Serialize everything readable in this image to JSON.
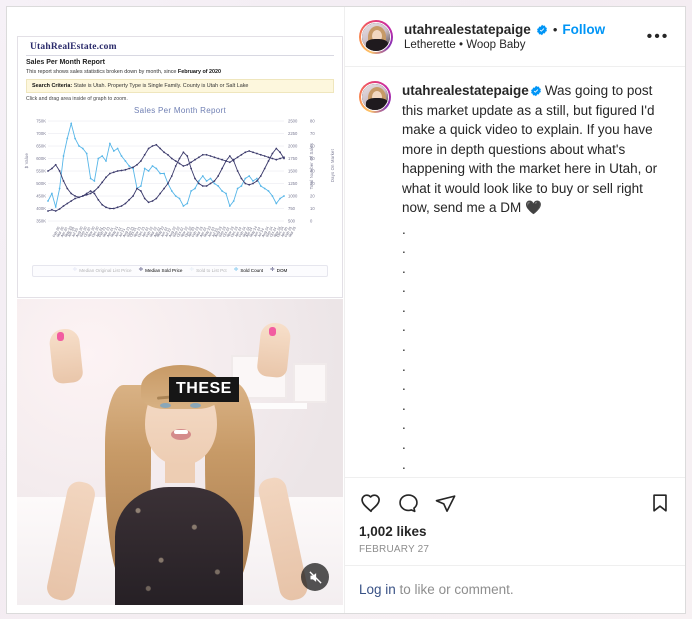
{
  "post": {
    "header": {
      "username": "utahrealestatepaige",
      "verified_icon": "verified-badge-icon",
      "separator": "•",
      "follow_label": "Follow",
      "location": "Letherette • Woop Baby",
      "more_menu": "•••"
    },
    "caption": {
      "username": "utahrealestatepaige",
      "text": "Was going to post this market update as a still, but figured I'd make a quick video to explain. If you have more in depth questions about what's happening with the market here in Utah, or what it would look like to buy or sell right now, send me a DM 🖤",
      "filler_dot": ".",
      "filler_dot_count": 13
    },
    "actions": {
      "like_icon": "heart-icon",
      "comment_icon": "comment-bubble-icon",
      "share_icon": "share-paper-plane-icon",
      "save_icon": "bookmark-icon"
    },
    "likes": "1,002 likes",
    "date": "FEBRUARY 27",
    "footer": {
      "link_label": "Log in",
      "rest_label": " to like or comment."
    },
    "media": {
      "mute_icon": "muted-speaker-icon",
      "video_caption": "THESE"
    }
  },
  "chart_shot": {
    "brand": "UtahRealEstate.com",
    "report_title": "Sales Per Month Report",
    "description_prefix": "This report shows sales statistics broken down by month, since ",
    "description_bold": "February of 2020",
    "criteria_label": "Search Criteria:",
    "criteria_value": " State is Utah.  Property Type is Single Family.  County is Utah or Salt Lake",
    "zoom_hint": "Click and drag area inside of graph to zoom."
  },
  "chart_data": {
    "type": "line",
    "title": "Sales Per Month Report",
    "xlabel": "",
    "ylabel": "$ Value",
    "y2label": "Total Number Of Sales",
    "y3label": "Days On Market",
    "ylim": [
      350000,
      750000
    ],
    "yticks": [
      "350K",
      "400K",
      "450K",
      "500K",
      "550K",
      "600K",
      "650K",
      "700K",
      "750K"
    ],
    "y2lim": [
      500,
      2500
    ],
    "y2ticks": [
      "500",
      "750",
      "1000",
      "1250",
      "1500",
      "1750",
      "2000",
      "2250",
      "2500"
    ],
    "y3lim": [
      0,
      80
    ],
    "y3ticks": [
      "0",
      "10",
      "20",
      "30",
      "40",
      "50",
      "60",
      "70",
      "80"
    ],
    "grid": true,
    "legend_position": "bottom",
    "legend": [
      {
        "name": "Median Original List Price",
        "color": "#9aa3d6",
        "active": false
      },
      {
        "name": "Median Sold Price",
        "color": "#3b3a6b",
        "active": true
      },
      {
        "name": "Sold to List Pct",
        "color": "#a8c6df",
        "active": false
      },
      {
        "name": "Sold Count",
        "color": "#57b6e8",
        "active": true
      },
      {
        "name": "DOM",
        "color": "#3b3a6b",
        "active": true
      }
    ],
    "categories": [
      "Feb 20",
      "Mar 20",
      "Apr 20",
      "May 20",
      "Jun 20",
      "Jul 20",
      "Aug 20",
      "Sep 20",
      "Oct 20",
      "Nov 20",
      "Dec 20",
      "Jan 21",
      "Feb 21",
      "Mar 21",
      "Apr 21",
      "May 21",
      "Jun 21",
      "Jul 21",
      "Aug 21",
      "Sep 21",
      "Oct 21",
      "Nov 21",
      "Dec 21",
      "Jan 22",
      "Feb 22",
      "Mar 22",
      "Apr 22",
      "May 22",
      "Jun 22",
      "Jul 22",
      "Aug 22",
      "Sep 22",
      "Oct 22",
      "Nov 22",
      "Dec 22",
      "Jan 23",
      "Feb 23",
      "Mar 23",
      "Apr 23",
      "May 23",
      "Jun 23",
      "Jul 23",
      "Aug 23",
      "Sep 23",
      "Oct 23",
      "Nov 23",
      "Dec 23",
      "Jan 24",
      "Feb 24",
      "Mar 24",
      "Apr 24",
      "May 24",
      "Jun 24",
      "Jul 24",
      "Aug 24",
      "Sep 24",
      "Oct 24",
      "Nov 24",
      "Dec 24",
      "Jan 25",
      "Feb 25",
      "Mar 25"
    ],
    "series": [
      {
        "name": "Sold Count",
        "axis": "y2",
        "color": "#57b6e8",
        "values": [
          900,
          1050,
          780,
          1150,
          1800,
          2150,
          2450,
          2150,
          2000,
          1950,
          1850,
          1350,
          1300,
          1750,
          1800,
          1700,
          2050,
          1900,
          1950,
          1800,
          1700,
          1600,
          1550,
          1150,
          1200,
          1550,
          1500,
          1600,
          1550,
          1450,
          1450,
          1250,
          1100,
          1000,
          950,
          800,
          850,
          1100,
          1150,
          1300,
          1400,
          1300,
          1350,
          1250,
          1200,
          1100,
          1050,
          800,
          900,
          1150,
          1200,
          1350,
          1400,
          1300,
          1350,
          1200,
          1150,
          1100,
          1000,
          850,
          950,
          1000
        ]
      },
      {
        "name": "Median Sold Price",
        "axis": "y",
        "color": "#3b3a6b",
        "values": [
          390000,
          395000,
          390000,
          398000,
          410000,
          420000,
          430000,
          440000,
          445000,
          450000,
          455000,
          460000,
          470000,
          485000,
          505000,
          525000,
          540000,
          545000,
          550000,
          552000,
          555000,
          560000,
          565000,
          575000,
          590000,
          615000,
          640000,
          650000,
          655000,
          640000,
          625000,
          615000,
          600000,
          590000,
          580000,
          570000,
          575000,
          585000,
          595000,
          605000,
          615000,
          615000,
          610000,
          605000,
          600000,
          595000,
          590000,
          585000,
          595000,
          605000,
          615000,
          625000,
          630000,
          625000,
          620000,
          615000,
          610000,
          605000,
          600000,
          595000,
          600000,
          605000
        ]
      },
      {
        "name": "DOM",
        "axis": "y3",
        "color": "#3b3a6b",
        "values": [
          40,
          42,
          45,
          40,
          32,
          26,
          22,
          20,
          19,
          20,
          22,
          24,
          22,
          17,
          13,
          11,
          10,
          10,
          11,
          12,
          14,
          17,
          20,
          26,
          24,
          18,
          15,
          16,
          18,
          22,
          26,
          30,
          36,
          44,
          50,
          55,
          52,
          42,
          34,
          30,
          28,
          28,
          30,
          32,
          36,
          42,
          48,
          52,
          48,
          40,
          34,
          30,
          29,
          30,
          32,
          36,
          42,
          48,
          54,
          58,
          55,
          50
        ]
      }
    ]
  }
}
